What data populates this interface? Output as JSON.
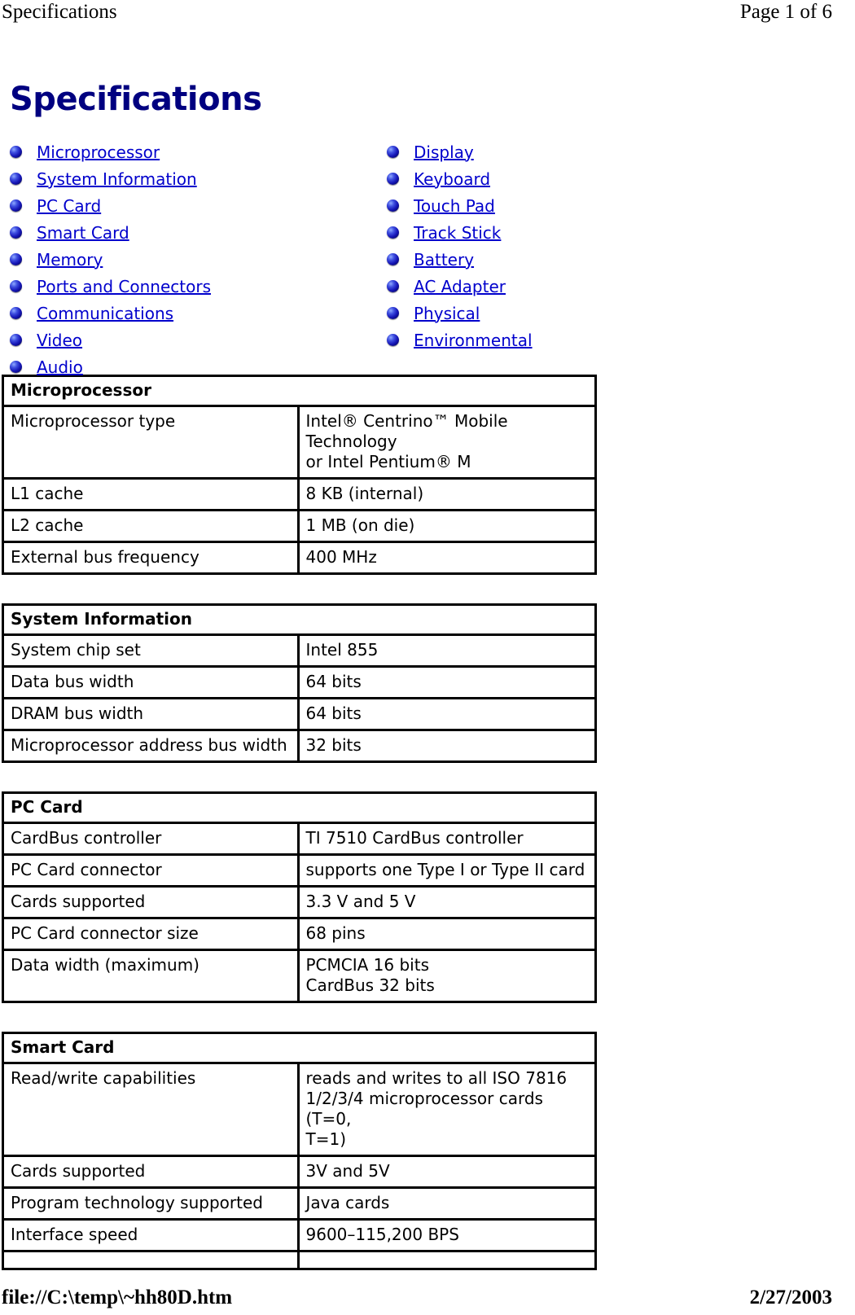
{
  "running_header": {
    "left": "Specifications",
    "right": "Page 1 of 6"
  },
  "running_footer": {
    "left": "file://C:\\temp\\~hh80D.htm",
    "right": "2/27/2003"
  },
  "page": {
    "title": "Specifications",
    "title_color": "#000080",
    "link_color": "#0000cc",
    "bullet_icon": "blue-sphere-bullet"
  },
  "toc": {
    "left_column": [
      {
        "label": "Microprocessor"
      },
      {
        "label": "System Information"
      },
      {
        "label": "PC Card"
      },
      {
        "label": "Smart Card"
      },
      {
        "label": "Memory"
      },
      {
        "label": "Ports and Connectors"
      },
      {
        "label": "Communications"
      },
      {
        "label": "Video"
      },
      {
        "label": "Audio"
      }
    ],
    "right_column": [
      {
        "label": "Display"
      },
      {
        "label": "Keyboard"
      },
      {
        "label": "Touch Pad"
      },
      {
        "label": "Track Stick"
      },
      {
        "label": "Battery"
      },
      {
        "label": "AC Adapter"
      },
      {
        "label": "Physical"
      },
      {
        "label": "Environmental"
      }
    ]
  },
  "tables": [
    {
      "heading": "Microprocessor",
      "rows": [
        {
          "key": "Microprocessor type",
          "value": "Intel® Centrino™ Mobile Technology\nor Intel Pentium® M"
        },
        {
          "key": "L1 cache",
          "value": "8 KB (internal)"
        },
        {
          "key": "L2 cache",
          "value": "1 MB (on die)"
        },
        {
          "key": "External bus frequency",
          "value": "400 MHz"
        }
      ]
    },
    {
      "heading": "System Information",
      "rows": [
        {
          "key": "System chip set",
          "value": "Intel 855"
        },
        {
          "key": "Data bus width",
          "value": "64 bits"
        },
        {
          "key": "DRAM bus width",
          "value": "64 bits"
        },
        {
          "key": "Microprocessor address bus width",
          "value": "32 bits"
        }
      ]
    },
    {
      "heading": "PC Card",
      "rows": [
        {
          "key": "CardBus controller",
          "value": "TI 7510 CardBus controller"
        },
        {
          "key": "PC Card connector",
          "value": "supports one Type I or Type II card"
        },
        {
          "key": "Cards supported",
          "value": "3.3 V and 5 V"
        },
        {
          "key": "PC Card connector size",
          "value": "68 pins"
        },
        {
          "key": "Data width (maximum)",
          "value": "PCMCIA 16 bits\nCardBus 32 bits"
        }
      ]
    },
    {
      "heading": "Smart Card",
      "rows": [
        {
          "key": "Read/write capabilities",
          "value": "reads and writes to all ISO 7816\n1/2/3/4 microprocessor cards (T=0,\nT=1)"
        },
        {
          "key": "Cards supported",
          "value": "3V and 5V"
        },
        {
          "key": "Program technology supported",
          "value": "Java cards"
        },
        {
          "key": "Interface speed",
          "value": "9600–115,200 BPS"
        },
        {
          "key": "",
          "value": ""
        }
      ]
    }
  ]
}
